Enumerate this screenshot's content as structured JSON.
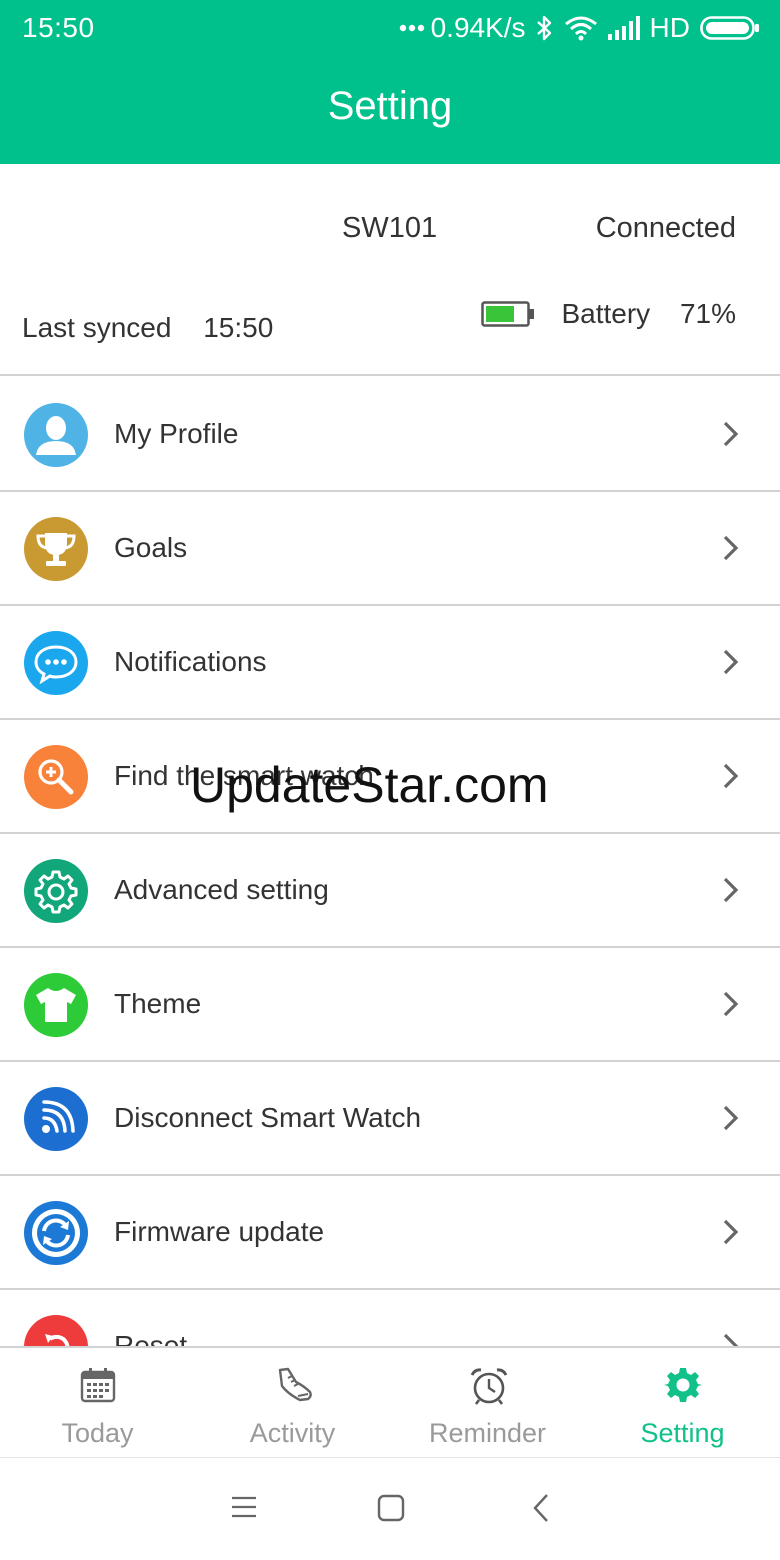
{
  "status_bar": {
    "time": "15:50",
    "network_speed": "0.94K/s",
    "network_type": "HD",
    "icons": [
      "more-dots-icon",
      "bluetooth-icon",
      "wifi-icon",
      "signal-icon",
      "battery-icon"
    ]
  },
  "header": {
    "title": "Setting"
  },
  "device": {
    "name": "SW101",
    "status": "Connected",
    "last_synced_label": "Last synced",
    "last_synced_time": "15:50",
    "battery_label": "Battery",
    "battery_percent": "71%",
    "battery_level": 0.71
  },
  "menu": {
    "items": [
      {
        "label": "My Profile",
        "icon": "profile-icon",
        "color": "#4fb3e6"
      },
      {
        "label": "Goals",
        "icon": "trophy-icon",
        "color": "#c99a32"
      },
      {
        "label": "Notifications",
        "icon": "chat-bubble-icon",
        "color": "#1aa7ee"
      },
      {
        "label": "Find the smart watch",
        "icon": "magnifier-icon",
        "color": "#f8823a"
      },
      {
        "label": "Advanced setting",
        "icon": "gear-icon",
        "color": "#12a77a"
      },
      {
        "label": "Theme",
        "icon": "shirt-icon",
        "color": "#2ecb38"
      },
      {
        "label": "Disconnect Smart Watch",
        "icon": "broadcast-icon",
        "color": "#1c6fd1"
      },
      {
        "label": "Firmware update",
        "icon": "sync-icon",
        "color": "#1c7ad6"
      },
      {
        "label": "Reset",
        "icon": "reset-icon",
        "color": "#ee3b3b"
      }
    ]
  },
  "watermark": "UpdateStar.com",
  "tabs": [
    {
      "label": "Today",
      "icon": "calendar-icon",
      "active": false
    },
    {
      "label": "Activity",
      "icon": "shoe-icon",
      "active": false
    },
    {
      "label": "Reminder",
      "icon": "alarm-clock-icon",
      "active": false
    },
    {
      "label": "Setting",
      "icon": "gear-icon",
      "active": true
    }
  ],
  "colors": {
    "brand": "#00c08b",
    "active_tab": "#12c08a",
    "inactive_tab": "#9a9a9a",
    "battery_fill": "#3ac43a"
  },
  "nav": {
    "icons": [
      "menu-lines-icon",
      "home-square-icon",
      "back-chevron-icon"
    ]
  }
}
